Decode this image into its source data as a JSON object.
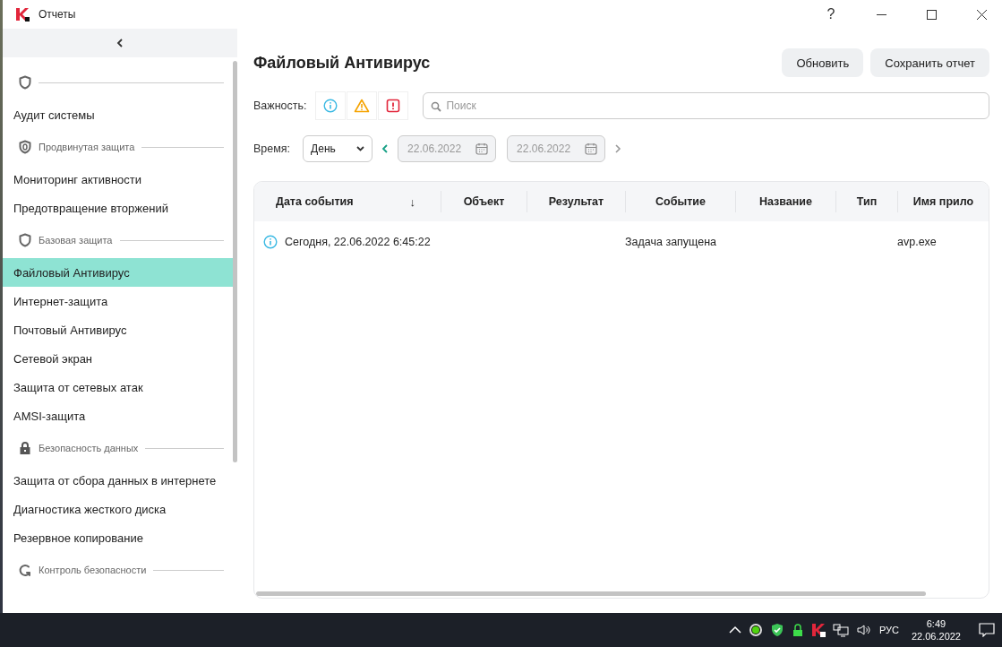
{
  "window": {
    "title": "Отчеты",
    "help": "?"
  },
  "sidebar": {
    "groups": [
      {
        "kind": "shield",
        "items": [
          {
            "label": "Аудит системы",
            "selected": false
          }
        ]
      },
      {
        "kind": "shield-advanced",
        "label": "Продвинутая защита",
        "items": [
          {
            "label": "Мониторинг активности",
            "selected": false
          },
          {
            "label": "Предотвращение вторжений",
            "selected": false
          }
        ]
      },
      {
        "kind": "shield",
        "label": "Базовая защита",
        "items": [
          {
            "label": "Файловый Антивирус",
            "selected": true
          },
          {
            "label": "Интернет-защита",
            "selected": false
          },
          {
            "label": "Почтовый Антивирус",
            "selected": false
          },
          {
            "label": "Сетевой экран",
            "selected": false
          },
          {
            "label": "Защита от сетевых атак",
            "selected": false
          },
          {
            "label": "AMSI-защита",
            "selected": false
          }
        ]
      },
      {
        "kind": "lock",
        "label": "Безопасность данных",
        "items": [
          {
            "label": "Защита от сбора данных в интернете",
            "selected": false
          },
          {
            "label": "Диагностика жесткого диска",
            "selected": false
          },
          {
            "label": "Резервное копирование",
            "selected": false
          }
        ]
      },
      {
        "kind": "refresh",
        "label": "Контроль безопасности"
      }
    ]
  },
  "main": {
    "title": "Файловый Антивирус",
    "buttons": [
      "Обновить",
      "Сохранить отчет"
    ],
    "severity_label": "Важность:",
    "severity_filters": [
      {
        "kind": "info"
      },
      {
        "kind": "warning"
      },
      {
        "kind": "critical"
      }
    ],
    "search": {
      "placeholder": "Поиск"
    },
    "time_label": "Время:",
    "period": "День",
    "date_from": "22.06.2022",
    "date_to": "22.06.2022"
  },
  "table": {
    "columns": [
      {
        "label": "Дата события",
        "sort": "↓"
      },
      {
        "label": "Объект"
      },
      {
        "label": "Результат"
      },
      {
        "label": "Событие"
      },
      {
        "label": "Название"
      },
      {
        "label": "Тип"
      },
      {
        "label": "Имя прило"
      }
    ],
    "rows": [
      {
        "kind": "info",
        "date": "Сегодня, 22.06.2022 6:45:22",
        "event": "Задача запущена",
        "app": "avp.exe"
      }
    ]
  },
  "taskbar": {
    "language": "РУС",
    "time": "6:49",
    "date": "22.06.2022"
  }
}
